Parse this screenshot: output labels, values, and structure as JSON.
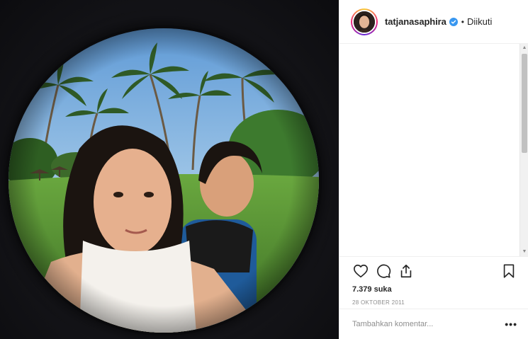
{
  "post": {
    "image_icon": "fisheye-photo",
    "colors": {
      "sky": "#7fb3e0",
      "grass": "#5f9a3b",
      "frame": "#141418"
    }
  },
  "header": {
    "username": "tatjanasaphira",
    "verified_icon": "verified-badge-icon",
    "separator": "•",
    "follow_status": "Diikuti"
  },
  "actions": {
    "like_icon": "heart-icon",
    "comment_icon": "comment-icon",
    "share_icon": "share-icon",
    "save_icon": "bookmark-icon",
    "likes_text": "7.379 suka",
    "date_text": "28 OKTOBER 2011"
  },
  "comment": {
    "placeholder": "Tambahkan komentar...",
    "more_label": "•••"
  },
  "colors": {
    "text": "#262626",
    "secondary": "#8e8e8e",
    "border": "#efefef",
    "verified": "#3897f0"
  }
}
